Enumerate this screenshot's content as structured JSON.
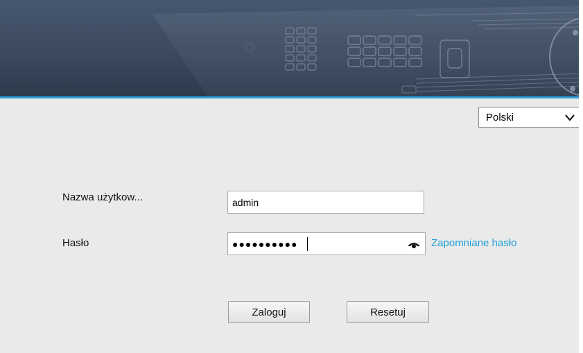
{
  "header": {
    "banner_icon": "dvr-device-image",
    "accent_color": "#2aa3dc"
  },
  "language": {
    "selected": "Polski",
    "icon": "chevron-down-icon"
  },
  "form": {
    "username_label": "Nazwa użytkow...",
    "username_value": "admin",
    "password_label": "Hasło",
    "password_value": "●●●●●●●●●●",
    "eye_icon": "eye-icon",
    "forgot_link": "Zapomniane hasło",
    "link_color": "#1d9fd8"
  },
  "buttons": {
    "login": "Zaloguj",
    "reset": "Resetuj"
  }
}
